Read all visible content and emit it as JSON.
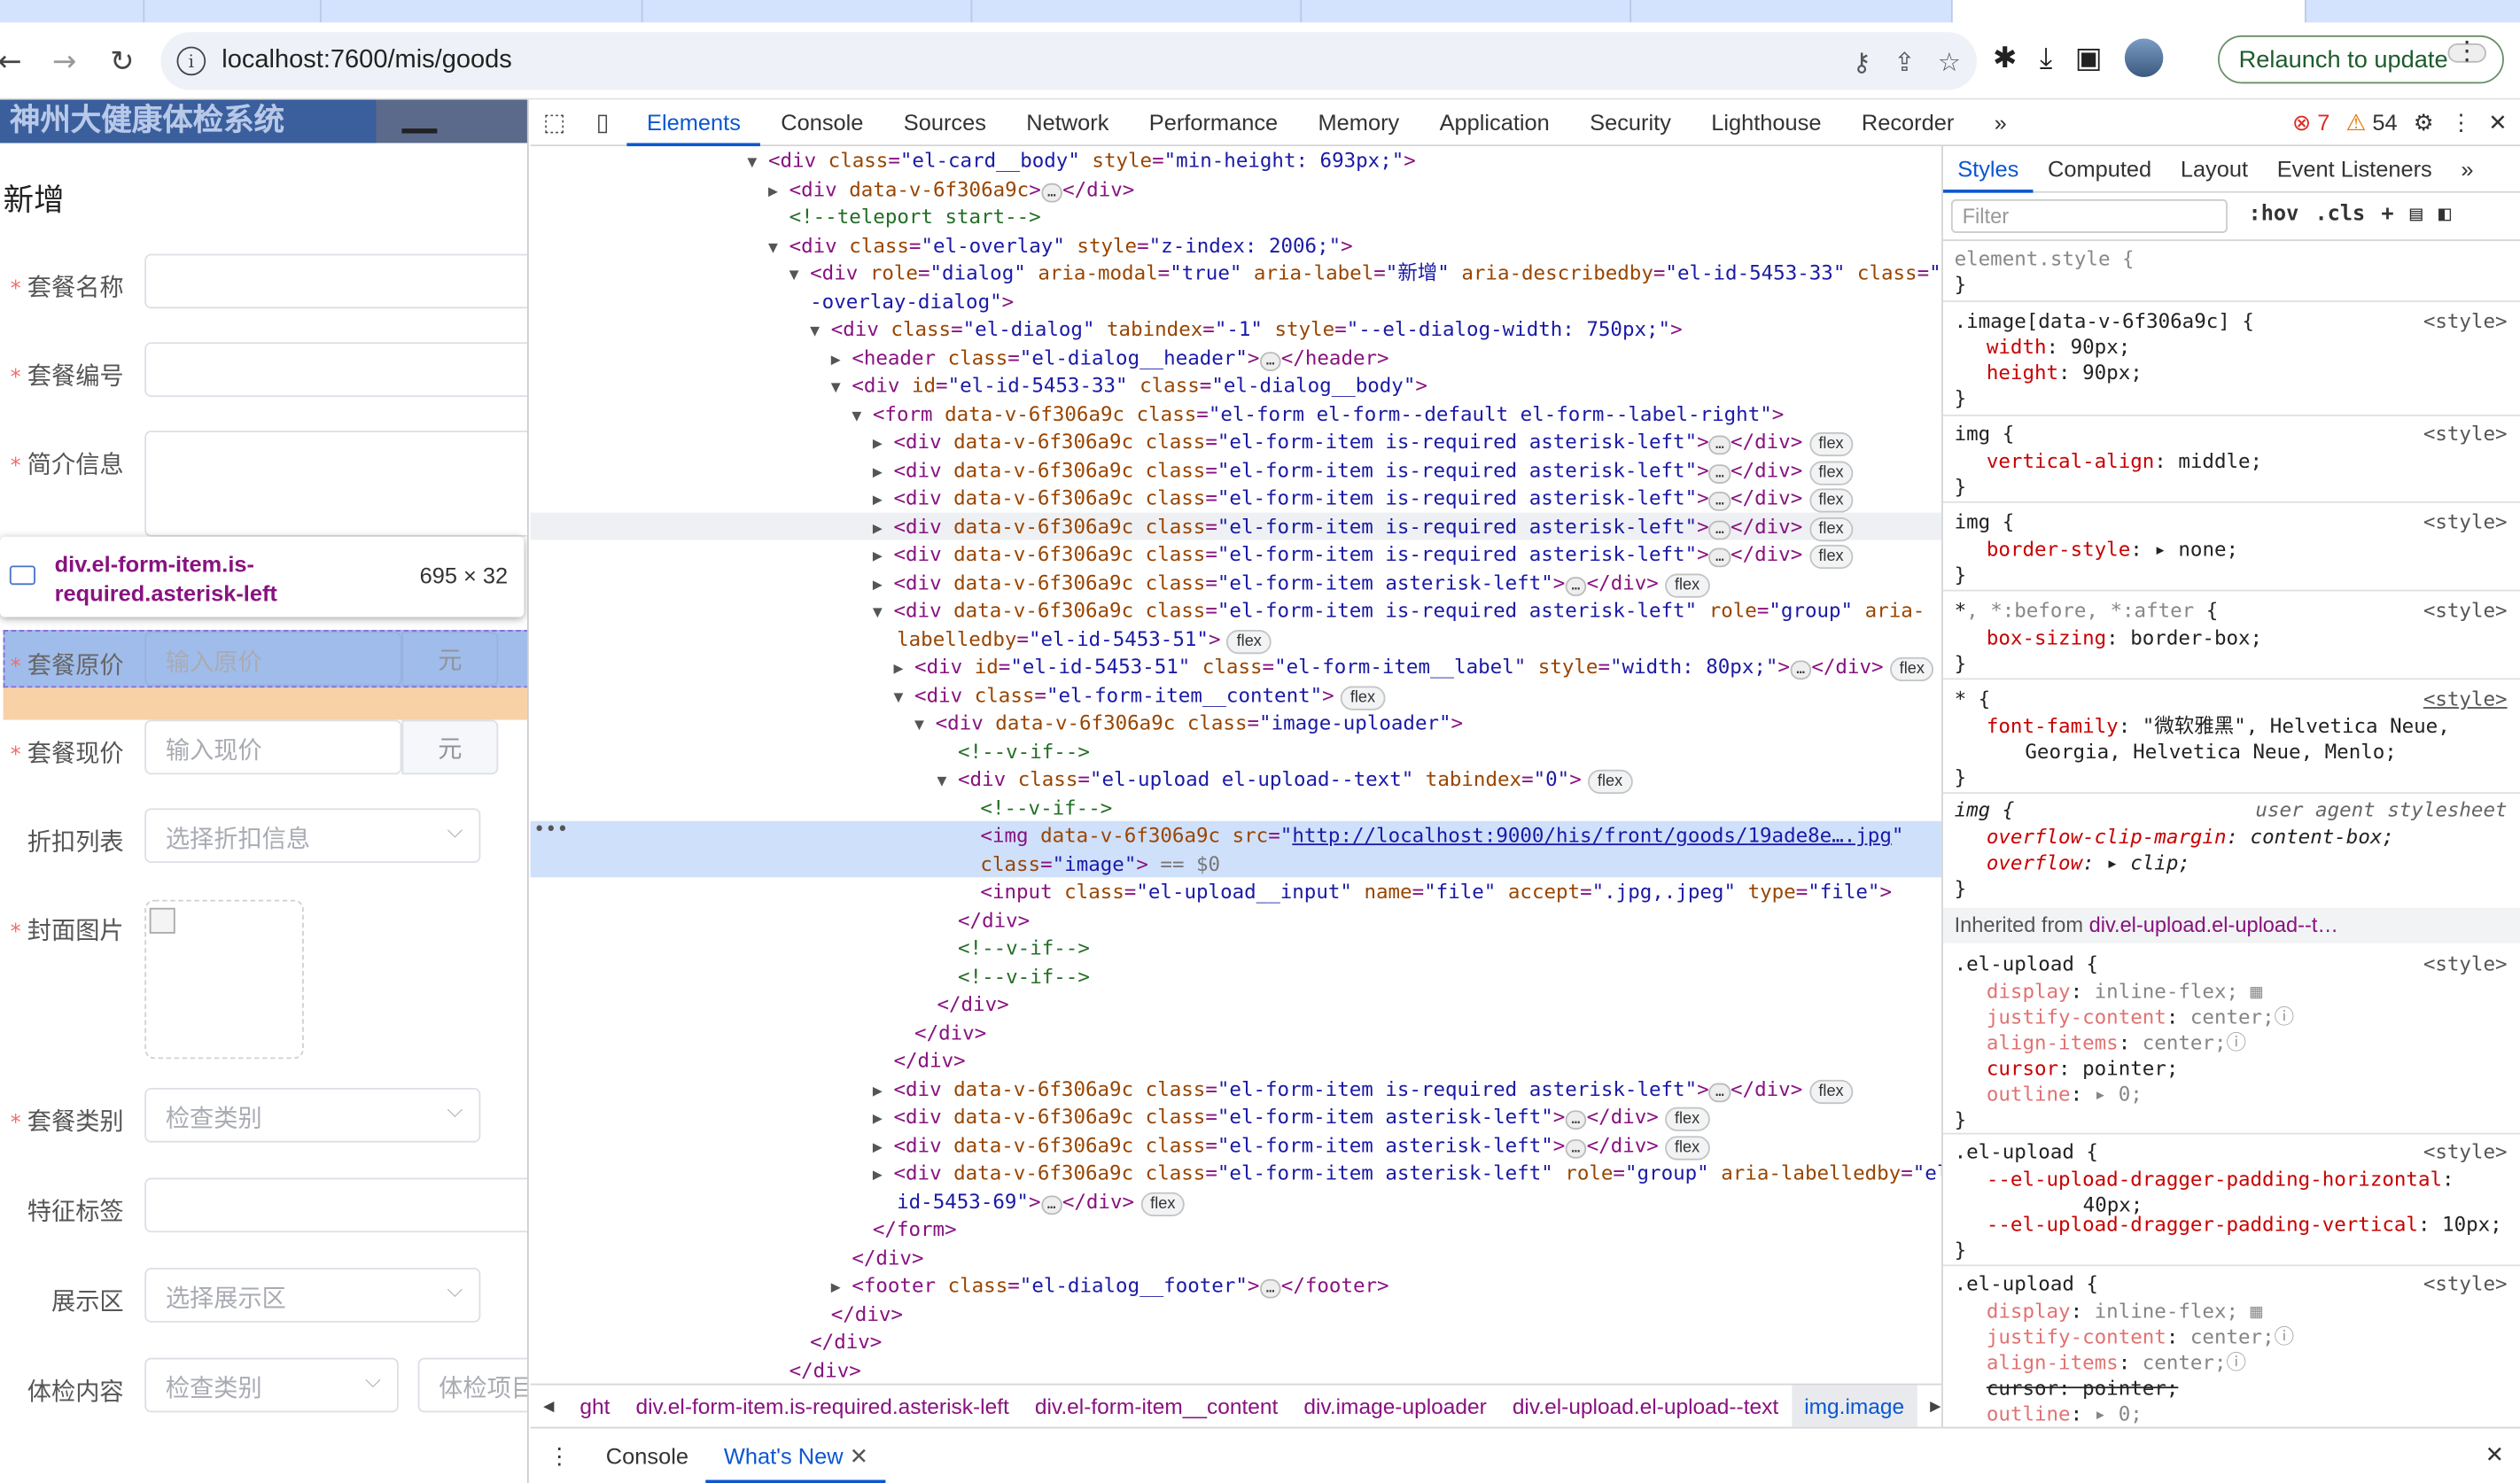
{
  "browser": {
    "url": "localhost:7600/mis/goods",
    "relaunch_label": "Relaunch to update"
  },
  "page": {
    "brand": "神州大健康体检系统",
    "dialog_title": "新增",
    "fields": [
      {
        "label": "套餐名称",
        "required": true,
        "placeholder": ""
      },
      {
        "label": "套餐编号",
        "required": true,
        "placeholder": ""
      },
      {
        "label": "简介信息",
        "required": true,
        "placeholder": ""
      },
      {
        "label": "套餐原价",
        "required": true,
        "placeholder": "输入原价",
        "append": "元"
      },
      {
        "label": "套餐现价",
        "required": true,
        "placeholder": "输入现价",
        "append": "元"
      },
      {
        "label": "折扣列表",
        "required": false,
        "placeholder": "选择折扣信息"
      },
      {
        "label": "封面图片",
        "required": true
      },
      {
        "label": "套餐类别",
        "required": true,
        "placeholder": "检查类别"
      },
      {
        "label": "特征标签",
        "required": false,
        "placeholder": ""
      },
      {
        "label": "展示区",
        "required": false,
        "placeholder": "选择展示区"
      },
      {
        "label": "体检内容",
        "required": false,
        "placeholder": "检查类别",
        "placeholder2": "体检项目"
      }
    ],
    "tooltip": {
      "name": "div.el-form-item.is-required.asterisk-left",
      "size": "695 × 32"
    }
  },
  "devtools": {
    "tabs": [
      "Elements",
      "Console",
      "Sources",
      "Network",
      "Performance",
      "Memory",
      "Application",
      "Security",
      "Lighthouse",
      "Recorder"
    ],
    "active_tab": "Elements",
    "errors": "7",
    "warnings": "54",
    "breadcrumb": [
      "ght",
      "div.el-form-item.is-required.asterisk-left",
      "div.el-form-item__content",
      "div.image-uploader",
      "div.el-upload.el-upload--text",
      "img.image"
    ],
    "drawer_tabs": [
      "Console",
      "What's New"
    ],
    "styles_tabs": [
      "Styles",
      "Computed",
      "Layout",
      "Event Listeners"
    ],
    "filter_placeholder": "Filter",
    "hov": ":hov",
    "cls": ".cls"
  }
}
